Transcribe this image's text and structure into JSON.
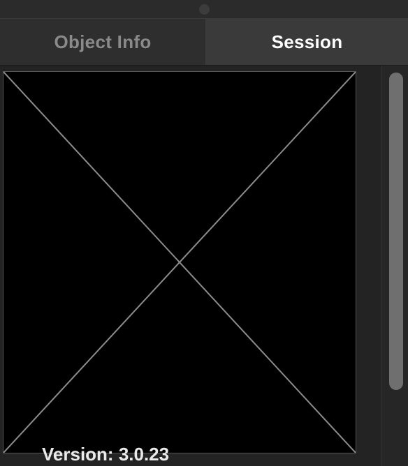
{
  "tabs": {
    "object_info": "Object Info",
    "session": "Session",
    "active": "Session"
  },
  "preview": {
    "placeholder_icon": "empty-image-placeholder-icon"
  },
  "footer": {
    "version_text": "Version: 3.0.23"
  },
  "colors": {
    "active_tab_text": "#ffffff",
    "inactive_tab_text": "#8a8a8a",
    "preview_background": "#000000",
    "panel_background": "#262626"
  }
}
